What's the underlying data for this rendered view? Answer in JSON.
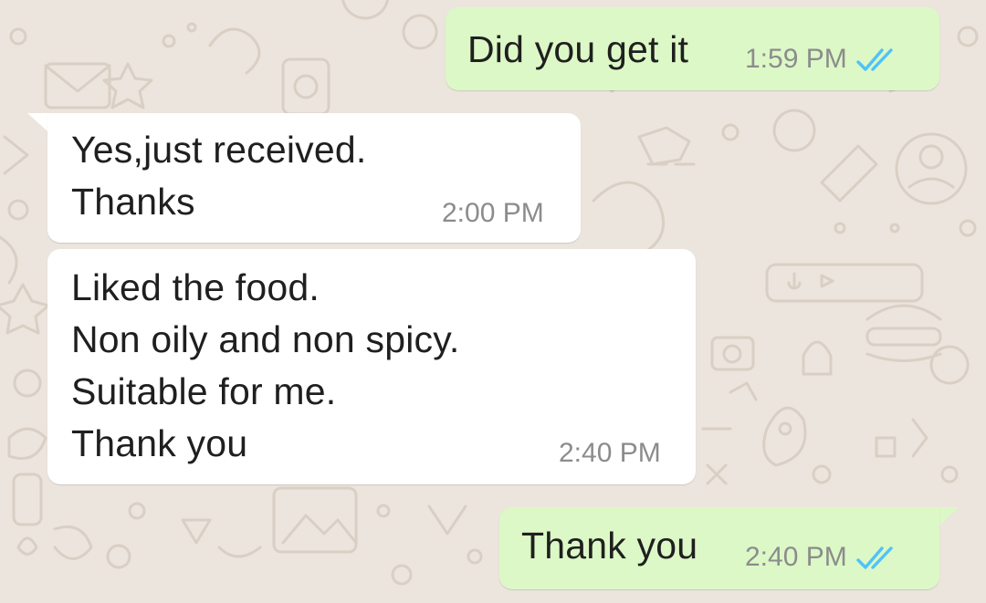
{
  "colors": {
    "background": "#ece5dd",
    "outgoing_bubble": "#dcf8c6",
    "incoming_bubble": "#ffffff",
    "read_tick": "#4fc3f7",
    "timestamp": "#8c8c8c"
  },
  "messages": [
    {
      "direction": "outgoing",
      "text": "Did you get it",
      "time": "1:59 PM",
      "status_icon": "double-check-read-icon"
    },
    {
      "direction": "incoming",
      "text": "Yes,just received.\nThanks",
      "time": "2:00 PM"
    },
    {
      "direction": "incoming",
      "text": "Liked the food.\nNon oily and non spicy.\nSuitable for me.\nThank you",
      "time": "2:40 PM"
    },
    {
      "direction": "outgoing",
      "text": "Thank you",
      "time": "2:40 PM",
      "status_icon": "double-check-read-icon"
    }
  ]
}
